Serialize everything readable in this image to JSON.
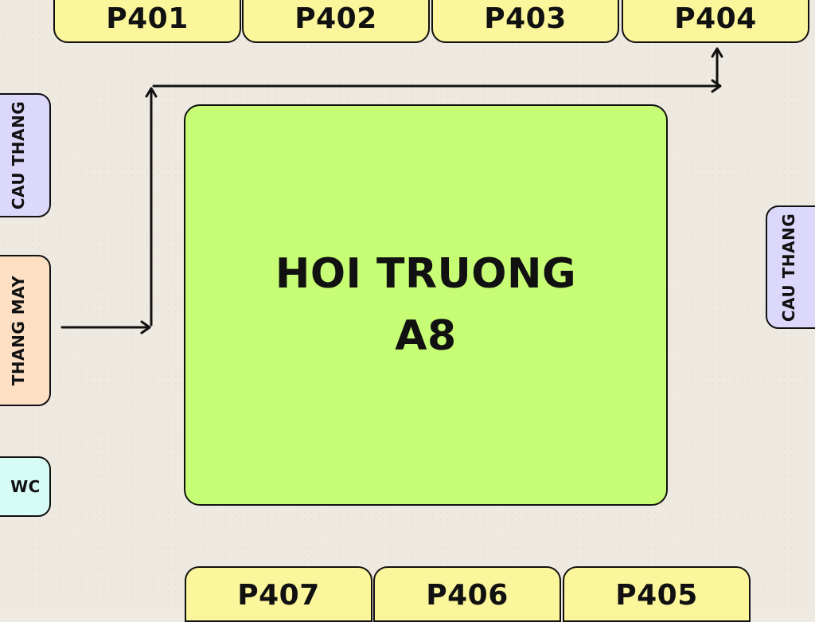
{
  "rooms_top": [
    "P401",
    "P402",
    "P403",
    "P404"
  ],
  "rooms_bottom": [
    "P407",
    "P406",
    "P405"
  ],
  "left_side": {
    "stairs_label": "CAU THANG",
    "elevator_label": "THANG MAY",
    "wc_label": "WC"
  },
  "right_side": {
    "stairs_label": "CAU THANG"
  },
  "hall": {
    "line1": "HOI TRUONG",
    "line2": "A8"
  },
  "colors": {
    "background": "#eeeae2",
    "room": "#fbf59b",
    "hall": "#c7fd74",
    "stairs": "#dcd8fb",
    "elevator": "#fde0c4",
    "wc": "#d7fbf5",
    "route": "#111111"
  },
  "route": {
    "from": "THANG MAY",
    "to": "P404"
  }
}
